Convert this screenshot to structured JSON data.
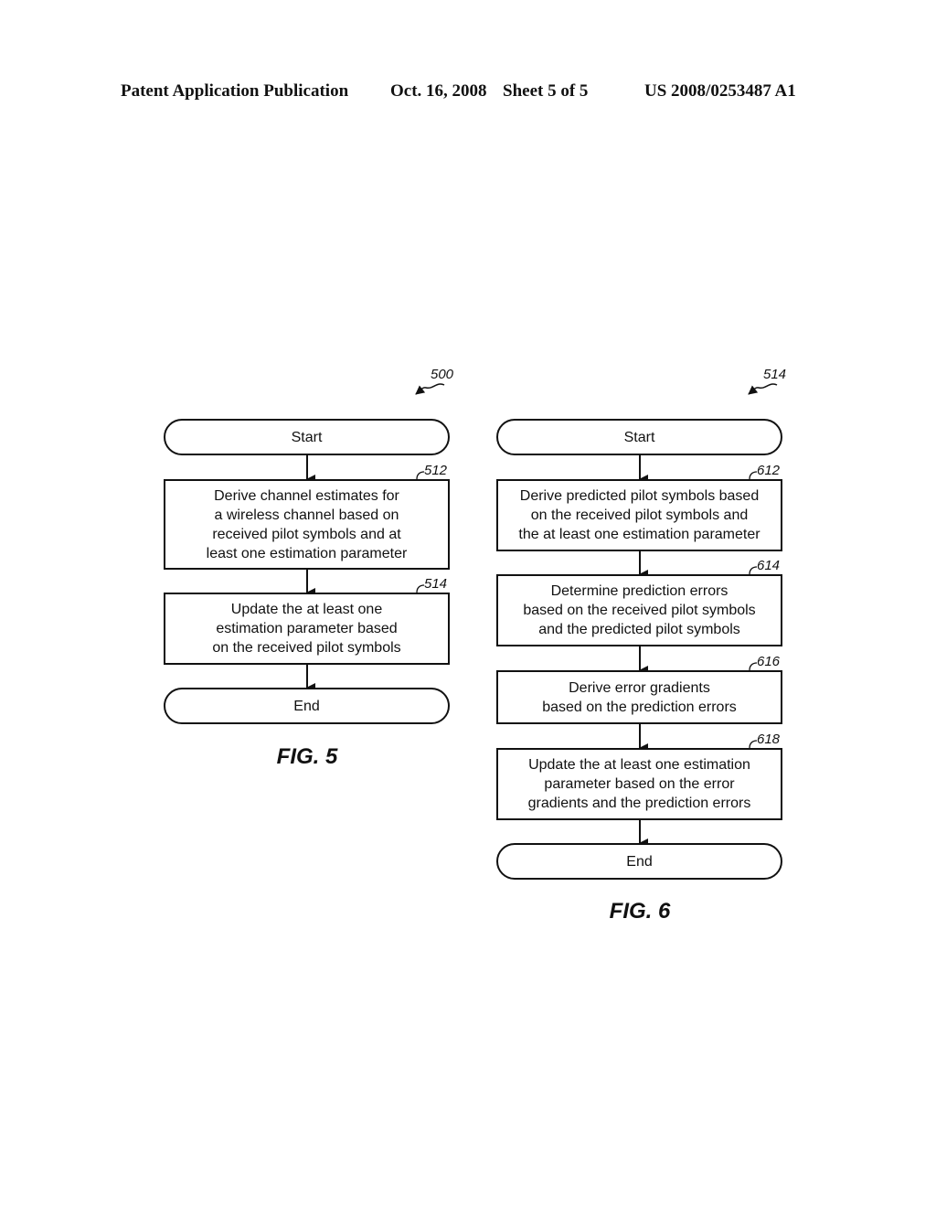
{
  "header": {
    "publication": "Patent Application Publication",
    "date": "Oct. 16, 2008",
    "sheet": "Sheet 5 of 5",
    "number": "US 2008/0253487 A1"
  },
  "fig5": {
    "ref": "500",
    "label": "FIG. 5",
    "start": "Start",
    "end": "End",
    "steps": [
      {
        "ref": "512",
        "text": "Derive channel estimates for\na wireless channel based on\nreceived pilot symbols and at\nleast one estimation parameter"
      },
      {
        "ref": "514",
        "text": "Update the at least one\nestimation parameter based\non the received pilot symbols"
      }
    ]
  },
  "fig6": {
    "ref": "514",
    "label": "FIG. 6",
    "start": "Start",
    "end": "End",
    "steps": [
      {
        "ref": "612",
        "text": "Derive predicted pilot symbols based\non the received pilot symbols and\nthe at least one estimation parameter"
      },
      {
        "ref": "614",
        "text": "Determine prediction errors\nbased on the received pilot symbols\nand the predicted pilot symbols"
      },
      {
        "ref": "616",
        "text": "Derive error gradients\nbased on the prediction errors"
      },
      {
        "ref": "618",
        "text": "Update the at least one estimation\nparameter based on the error\ngradients and the prediction errors"
      }
    ]
  }
}
